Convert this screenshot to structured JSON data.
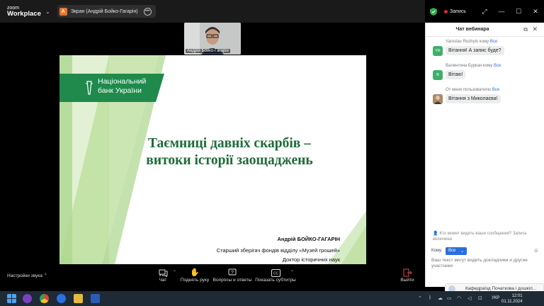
{
  "app": {
    "brand_small": "zoom",
    "brand": "Workplace",
    "screen_tab_initial": "A",
    "screen_tab_title": "Экран (Андрій Бойко-Гагарін)",
    "recording_label": "Запись"
  },
  "video": {
    "name_label": "Андрій Бойко-Гагарін"
  },
  "slide": {
    "logo_line1": "Національний",
    "logo_line2": "банк України",
    "title_line1": "Таємниці давніх скарбів –",
    "title_line2": "витоки історії заощаджень",
    "author": "Андрій БОЙКО-ГАГАРІН",
    "position1": "Старший зберігач фондів відділу «Музей грошей»",
    "position2": "Доктор історичних наук"
  },
  "toolbar": {
    "sound_settings": "Настройки звука",
    "chat": "Чат",
    "raise_hand": "Поднять руку",
    "qa": "Вопросы и ответы",
    "subtitles": "Показать субтитры",
    "leave": "Выйти"
  },
  "chat": {
    "title": "Чат вебинара",
    "messages": [
      {
        "sender": "Yaroslav Rozhylo",
        "to_word": "кому",
        "to": "Все",
        "avatar": "YR",
        "avatar_color": "#3fae6b",
        "text": "Вітання! А запис буде?"
      },
      {
        "sender": "Валентина Буркан",
        "to_word": "кому",
        "to": "Все",
        "avatar": "В",
        "avatar_color": "#3fae6b",
        "text": "Вітаю!"
      },
      {
        "sender": "От меня пользователю",
        "to_word": "",
        "to": "Все",
        "avatar": "",
        "avatar_color": "#8b6b4a",
        "text": "Вітання з Миколаєва!"
      }
    ],
    "notice": "Кто может видеть ваши сообщения? Запись включена",
    "to_label": "Кому:",
    "to_value": "Все",
    "input_placeholder": "Ваш текст могут видеть докладчики и другие участники"
  },
  "taskbar": {
    "notification": "Кафедраїзд Початкова і дошкіл...",
    "lang": "УКР",
    "time": "12:01",
    "date": "01.11.2024"
  },
  "colors": {
    "accent": "#2d6ee0",
    "slide_green": "#1f6b3a",
    "nbu_green": "#1f8a4c"
  }
}
